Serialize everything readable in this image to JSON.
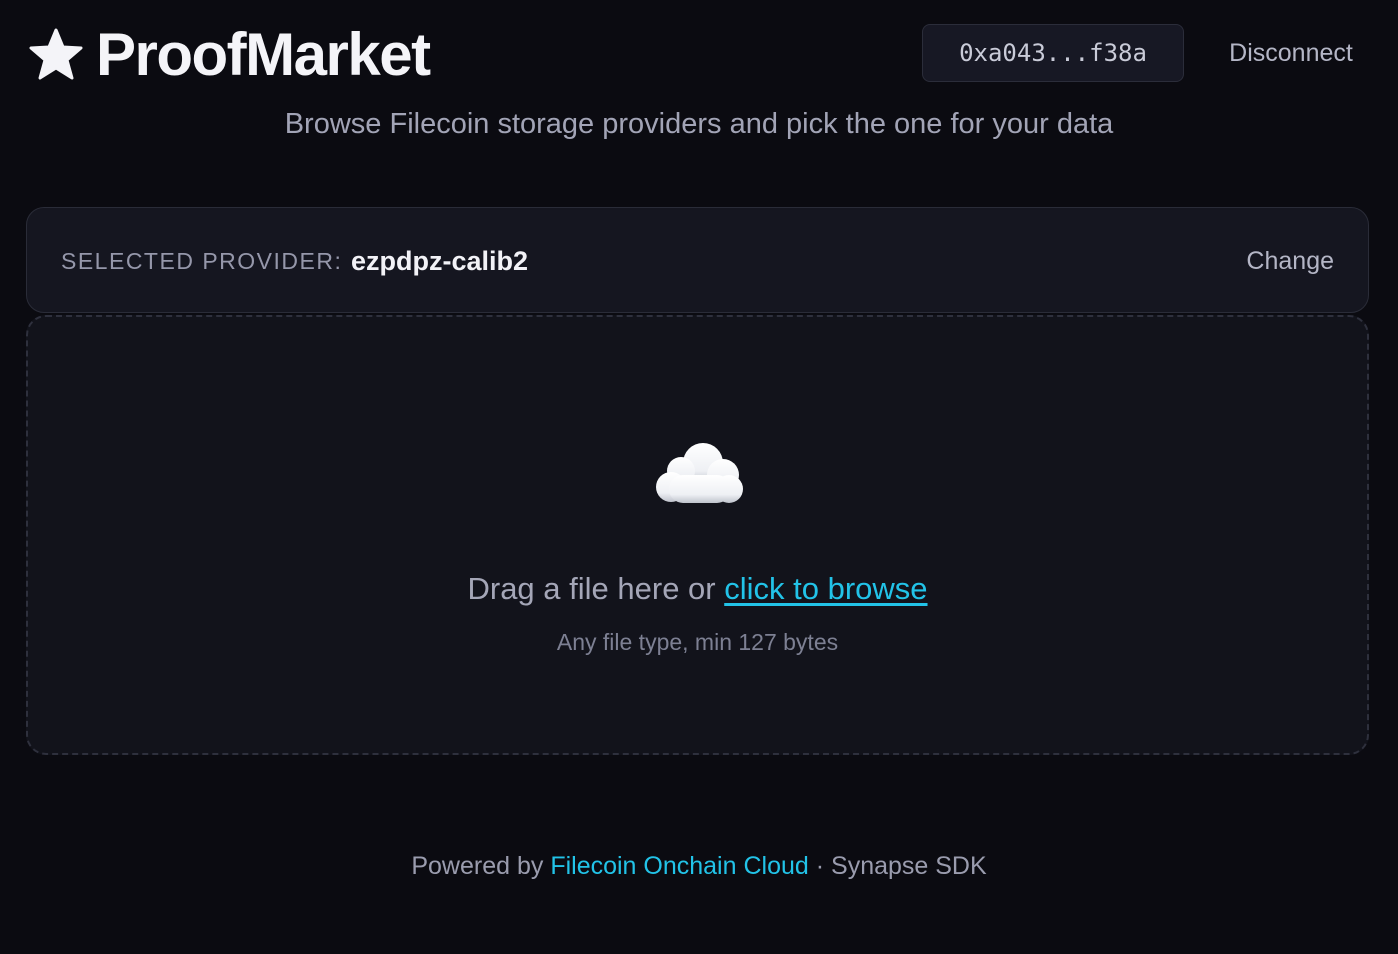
{
  "header": {
    "brand_title": "ProofMarket",
    "brand_icon": "star-icon",
    "wallet_address": "0xa043...f38a",
    "disconnect_label": "Disconnect"
  },
  "subtitle": "Browse Filecoin storage providers and pick the one for your data",
  "provider": {
    "label": "SELECTED PROVIDER:",
    "name": "ezpdpz-calib2",
    "change_label": "Change"
  },
  "dropzone": {
    "icon": "cloud-icon",
    "prompt_prefix": "Drag a file here or ",
    "browse_link": "click to browse",
    "hint": "Any file type, min 127 bytes"
  },
  "footer": {
    "powered_by": "Powered by ",
    "link_text": "Filecoin Onchain Cloud",
    "suffix": " · Synapse SDK"
  },
  "colors": {
    "background": "#0b0b11",
    "accent": "#22c3e8",
    "card": "#151620",
    "border": "#2a2c38"
  }
}
